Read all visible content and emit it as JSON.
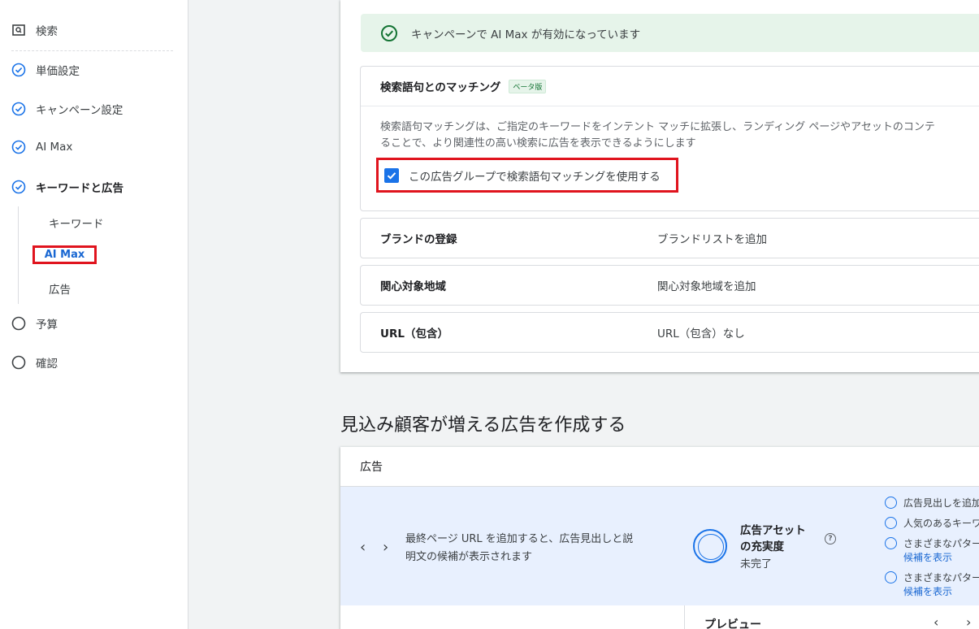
{
  "sidebar": {
    "search": "検索",
    "bid": "単価設定",
    "campaign": "キャンペーン設定",
    "aimax": "AI Max",
    "keywords_ads": "キーワードと広告",
    "sub_keywords": "キーワード",
    "sub_aimax": "AI Max",
    "sub_ads": "広告",
    "budget": "予算",
    "review": "確認"
  },
  "banner": {
    "text": "キャンペーンで AI Max が有効になっています"
  },
  "matching": {
    "title": "検索語句とのマッチング",
    "badge": "ベータ版",
    "desc1": "検索語句マッチングは、ご指定のキーワードをインテント マッチに拡張し、ランディング ページやアセットのコンテ",
    "desc2": "ることで、より関連性の高い検索に広告を表示できるようにします",
    "checkbox_label": "この広告グループで検索語句マッチングを使用する"
  },
  "rows": [
    {
      "label": "ブランドの登録",
      "value": "ブランドリストを追加"
    },
    {
      "label": "関心対象地域",
      "value": "関心対象地域を追加"
    },
    {
      "label": "URL（包含）",
      "value": "URL（包含）なし"
    }
  ],
  "section_title": "見込み顧客が増える広告を作成する",
  "ad": {
    "header": "広告",
    "message1": "最終ページ URL を追加すると、広告見出しと説",
    "message2": "明文の候補が表示されます",
    "strength_title1": "広告アセット",
    "strength_title2": "の充実度",
    "strength_status": "未完了",
    "help": "?",
    "suggestions": [
      "広告見出しを追加",
      "人気のあるキーワ",
      "さまざまなパター",
      "さまざまなパター"
    ],
    "suggestion_link": "候補を表示",
    "preview": "プレビュー"
  },
  "colors": {
    "accent": "#1a73e8",
    "highlight": "#e0141e",
    "banner_bg": "#e6f4ea",
    "ad_panel_bg": "#e8f0fe"
  }
}
